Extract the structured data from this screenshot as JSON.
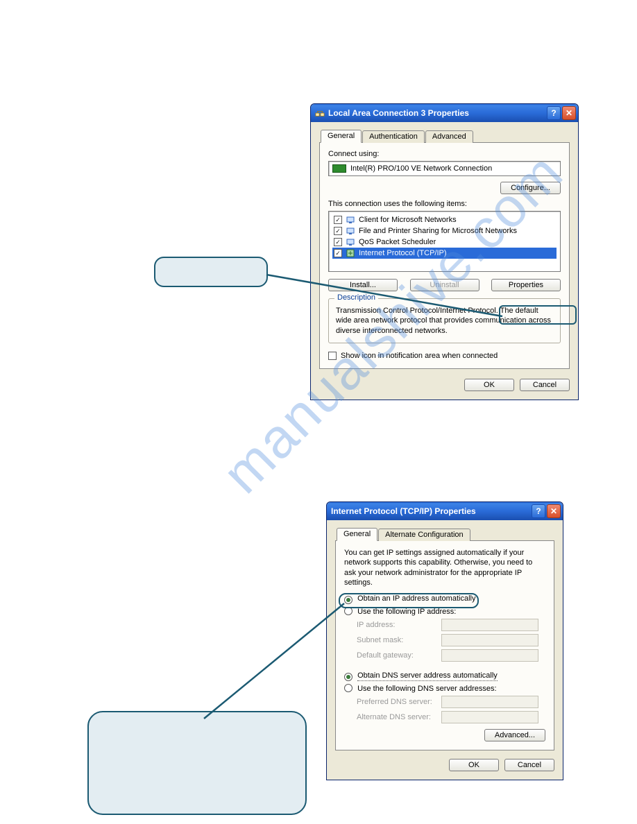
{
  "watermark": "manualshive.com",
  "dialog1": {
    "title": "Local Area Connection 3 Properties",
    "tabs": [
      "General",
      "Authentication",
      "Advanced"
    ],
    "connect_using_label": "Connect using:",
    "adapter_name": "Intel(R) PRO/100 VE Network Connection",
    "configure_btn": "Configure...",
    "items_label": "This connection uses the following items:",
    "items": [
      {
        "label": "Client for Microsoft Networks",
        "checked": true,
        "selected": false
      },
      {
        "label": "File and Printer Sharing for Microsoft Networks",
        "checked": true,
        "selected": false
      },
      {
        "label": "QoS Packet Scheduler",
        "checked": true,
        "selected": false
      },
      {
        "label": "Internet Protocol (TCP/IP)",
        "checked": true,
        "selected": true
      }
    ],
    "install_btn": "Install...",
    "uninstall_btn": "Uninstall",
    "properties_btn": "Properties",
    "desc_title": "Description",
    "desc_text": "Transmission Control Protocol/Internet Protocol. The default wide area network protocol that provides communication across diverse interconnected networks.",
    "show_icon_label": "Show icon in notification area when connected",
    "ok_btn": "OK",
    "cancel_btn": "Cancel"
  },
  "dialog2": {
    "title": "Internet Protocol (TCP/IP) Properties",
    "tabs": [
      "General",
      "Alternate Configuration"
    ],
    "intro_text": "You can get IP settings assigned automatically if your network supports this capability. Otherwise, you need to ask your network administrator for the appropriate IP settings.",
    "radio_auto_ip": "Obtain an IP address automatically",
    "radio_manual_ip": "Use the following IP address:",
    "ip_label": "IP address:",
    "subnet_label": "Subnet mask:",
    "gateway_label": "Default gateway:",
    "radio_auto_dns": "Obtain DNS server address automatically",
    "radio_manual_dns": "Use the following DNS server addresses:",
    "pref_dns_label": "Preferred DNS server:",
    "alt_dns_label": "Alternate DNS server:",
    "advanced_btn": "Advanced...",
    "ok_btn": "OK",
    "cancel_btn": "Cancel"
  }
}
